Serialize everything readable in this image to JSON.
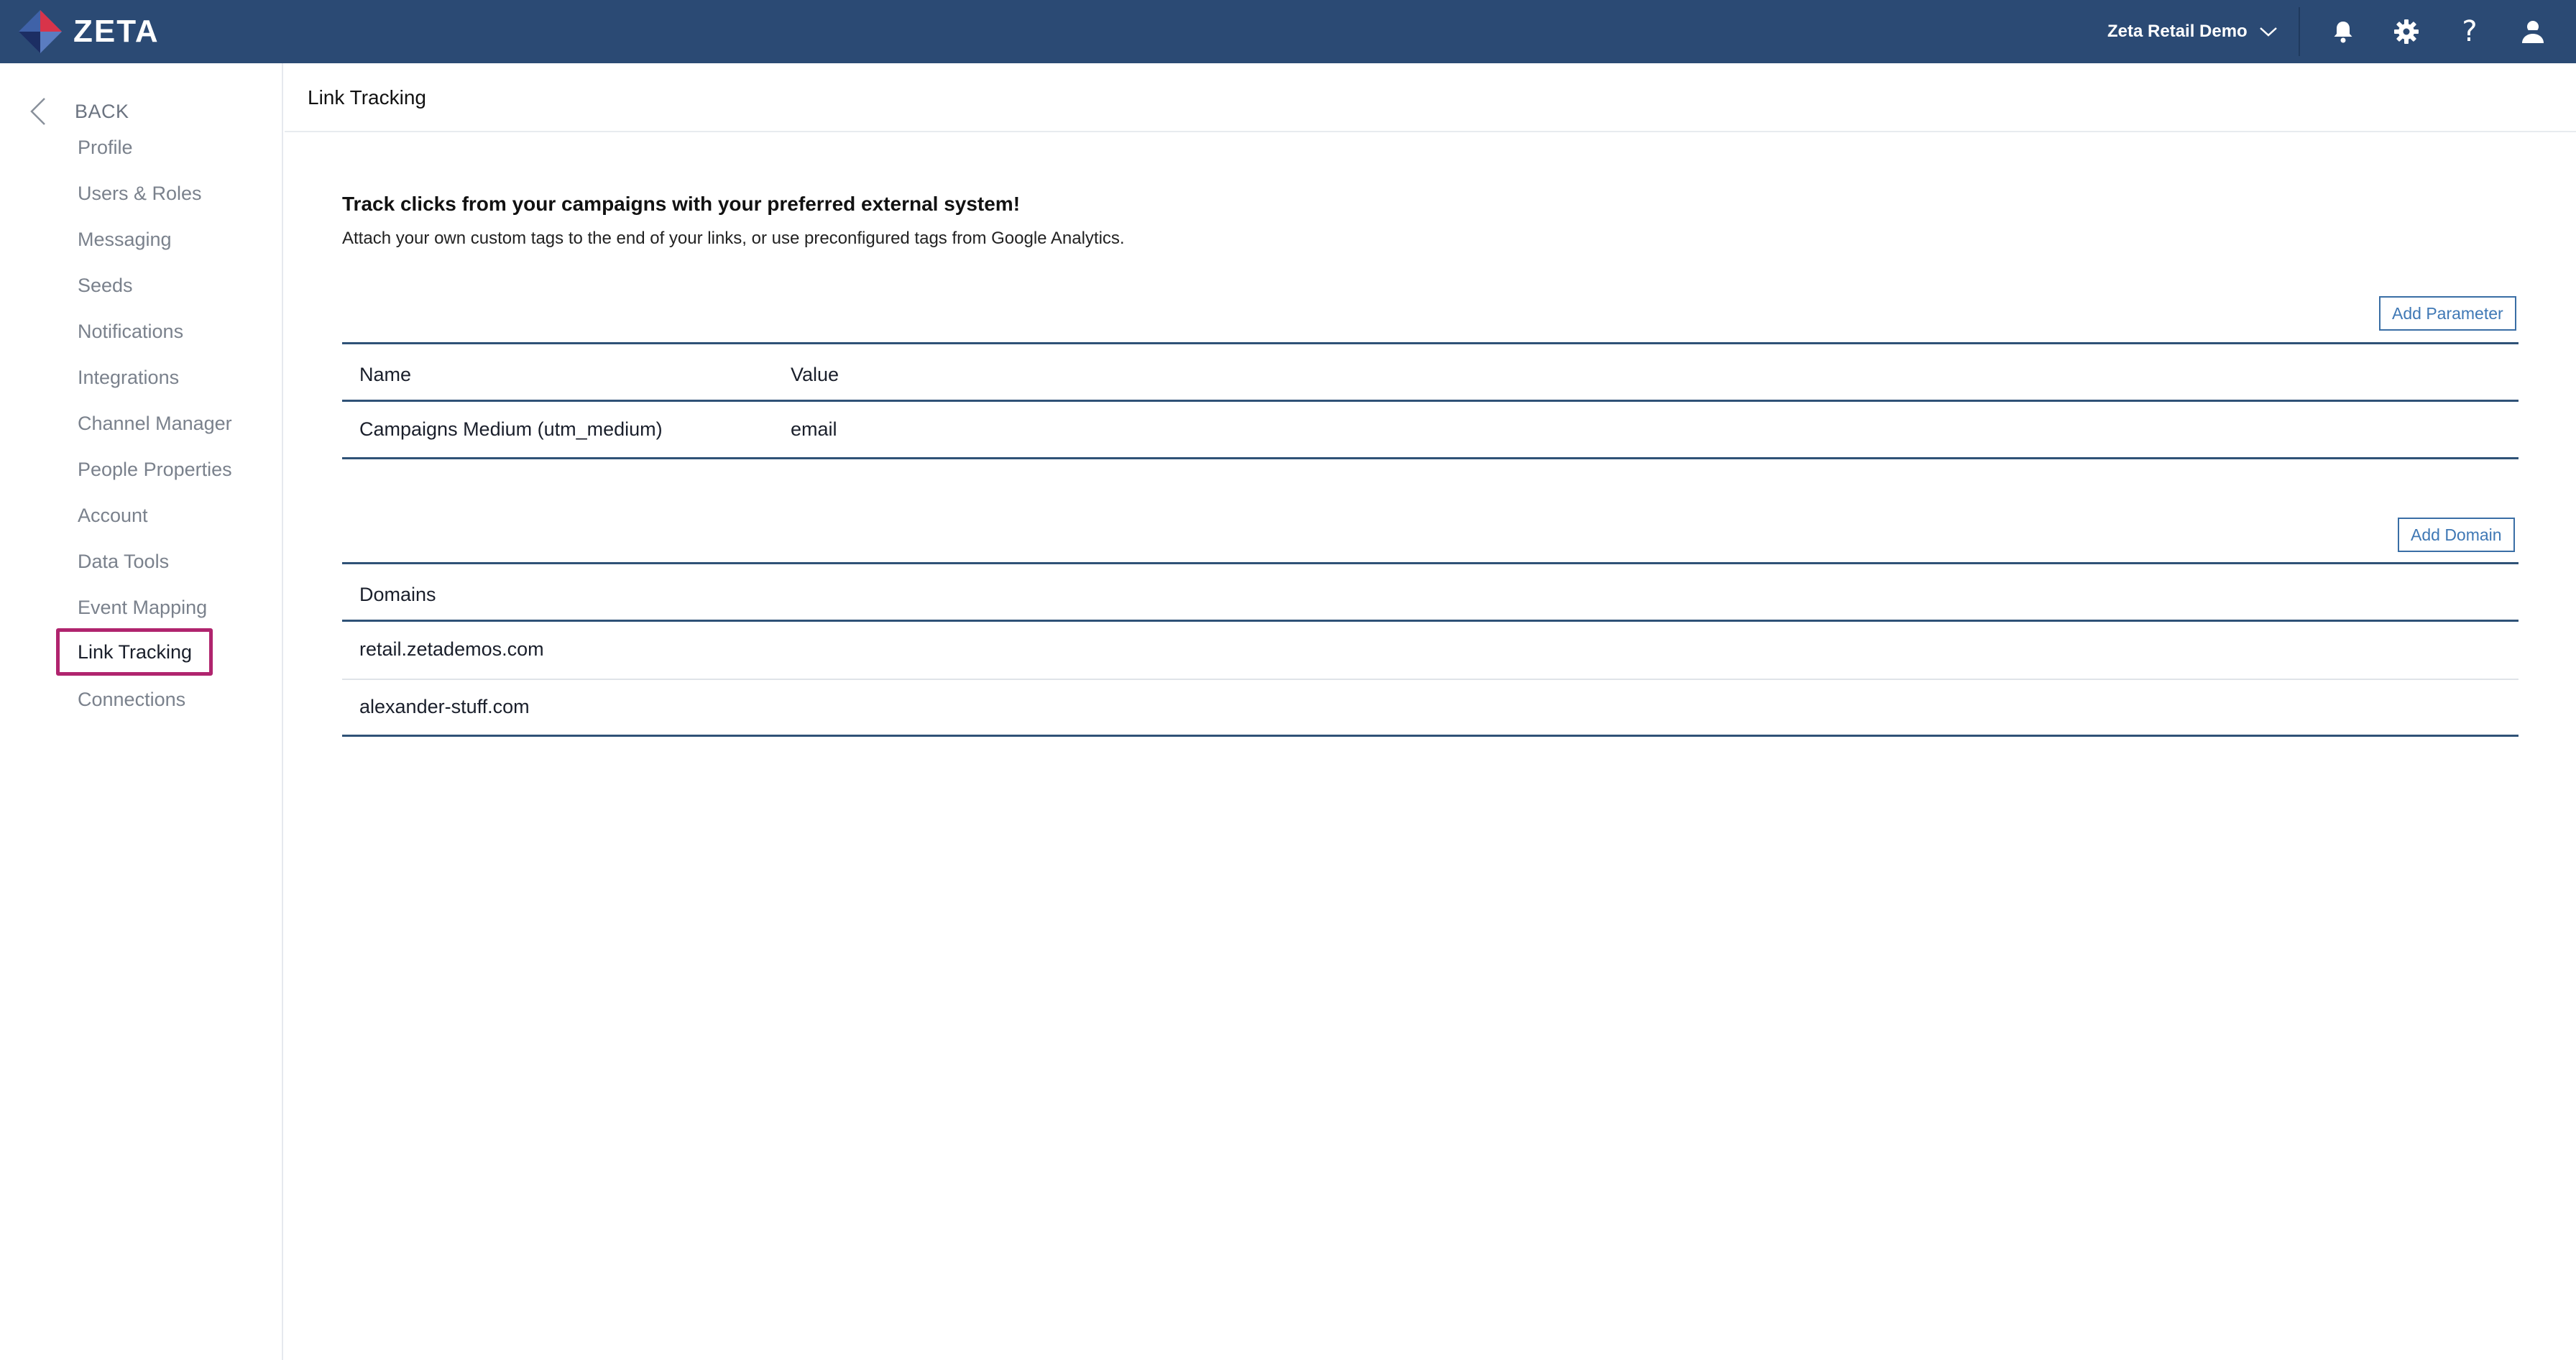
{
  "topbar": {
    "brand": "ZETA",
    "account_name": "Zeta Retail Demo",
    "icons": [
      "bell-icon",
      "gear-icon",
      "help-icon",
      "user-icon"
    ],
    "help_glyph": "?"
  },
  "sidebar": {
    "back_label": "BACK",
    "items": [
      {
        "label": "Profile"
      },
      {
        "label": "Users & Roles"
      },
      {
        "label": "Messaging"
      },
      {
        "label": "Seeds"
      },
      {
        "label": "Notifications"
      },
      {
        "label": "Integrations"
      },
      {
        "label": "Channel Manager"
      },
      {
        "label": "People Properties"
      },
      {
        "label": "Account"
      },
      {
        "label": "Data Tools"
      },
      {
        "label": "Event Mapping"
      },
      {
        "label": "Link Tracking"
      },
      {
        "label": "Connections"
      }
    ],
    "active_item": "Link Tracking"
  },
  "main": {
    "page_title": "Link Tracking",
    "intro_title": "Track clicks from your campaigns with your preferred external system!",
    "intro_text": "Attach your own custom tags to the end of your links, or use preconfigured tags from Google Analytics.",
    "parameters": {
      "add_button_label": "Add Parameter",
      "columns": [
        "Name",
        "Value"
      ],
      "rows": [
        {
          "name": "Campaigns Medium (utm_medium)",
          "value": "email"
        }
      ]
    },
    "domains": {
      "add_button_label": "Add Domain",
      "column": "Domains",
      "rows": [
        "retail.zetademos.com",
        "alexander-stuff.com"
      ]
    }
  },
  "colors": {
    "topbar_bg": "#2b4a74",
    "active_outline": "#b0246e",
    "table_rule": "#2f5277",
    "button_text": "#3f78b5"
  }
}
